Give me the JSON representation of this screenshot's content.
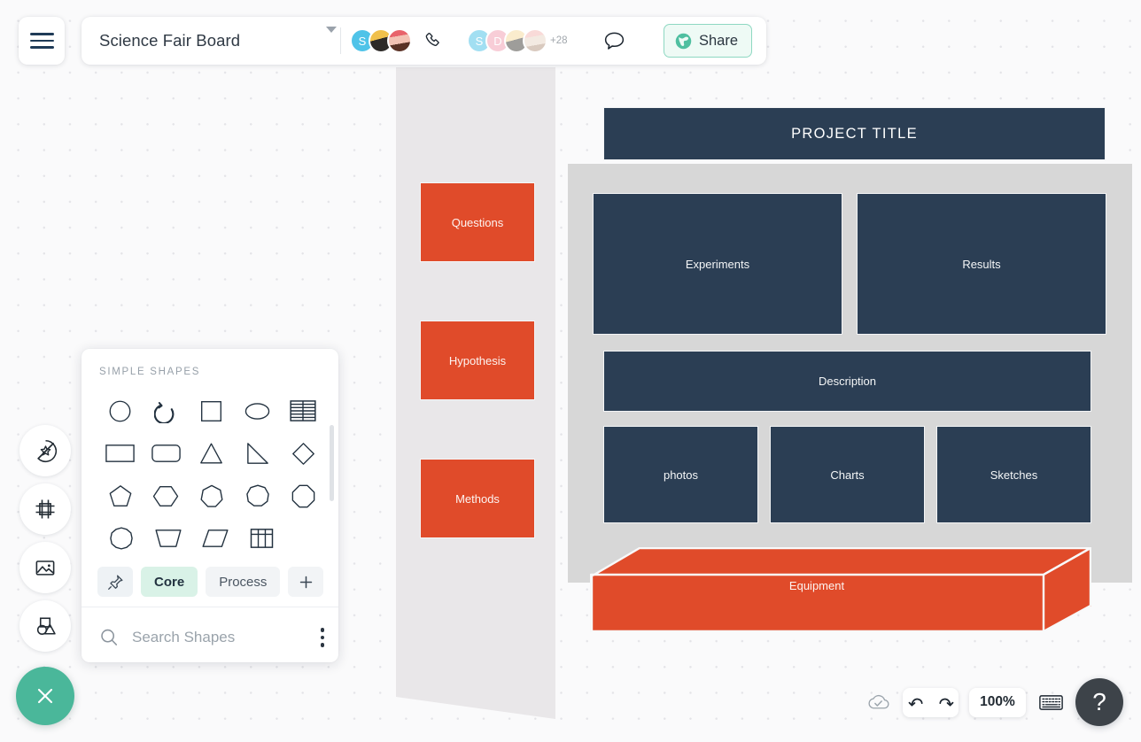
{
  "app": {
    "board_title": "Science Fair Board",
    "menu_icon": "hamburger-menu-icon",
    "title_caret_icon": "chevron-down-icon",
    "call_icon": "phone-icon",
    "comment_icon": "comment-bubble-icon",
    "share_label": "Share",
    "share_icon": "globe-icon",
    "overflow_count": "+28"
  },
  "collaborators": {
    "active": [
      {
        "name": "S",
        "type": "initial",
        "color": "#4fc3e8"
      },
      {
        "name": "avatar-photo-1",
        "type": "photo"
      },
      {
        "name": "avatar-photo-2",
        "type": "photo"
      }
    ],
    "viewers": [
      {
        "name": "S",
        "type": "initial",
        "color": "#4fc3e8"
      },
      {
        "name": "D",
        "type": "initial",
        "color": "#f2a0b4"
      },
      {
        "name": "avatar-photo-3",
        "type": "photo"
      },
      {
        "name": "avatar-photo-4",
        "type": "photo"
      }
    ]
  },
  "rail": {
    "items": [
      {
        "name": "sticker-tool",
        "icon": "star-sticker-icon"
      },
      {
        "name": "frame-tool",
        "icon": "frame-icon"
      },
      {
        "name": "image-tool",
        "icon": "image-icon"
      },
      {
        "name": "shapes-tool",
        "icon": "shapes-icon"
      }
    ],
    "close_icon": "close-x-icon"
  },
  "shapes_panel": {
    "header": "SIMPLE SHAPES",
    "shapes": [
      [
        "circle",
        "arc-arrow",
        "square",
        "ellipse",
        "table-lines"
      ],
      [
        "rectangle",
        "rounded-rectangle",
        "triangle",
        "right-triangle",
        "diamond"
      ],
      [
        "pentagon",
        "hexagon",
        "heptagon",
        "nonagon",
        "octagon"
      ],
      [
        "decagon",
        "trapezoid",
        "parallelogram",
        "table-grid"
      ]
    ],
    "tabs": [
      {
        "label": "",
        "name": "pin-tab",
        "icon": "pin-icon",
        "active": false
      },
      {
        "label": "Core",
        "name": "core-tab",
        "active": true
      },
      {
        "label": "Process",
        "name": "process-tab",
        "active": false
      },
      {
        "label": "",
        "name": "add-tab",
        "icon": "plus-icon",
        "active": false
      }
    ],
    "search_placeholder": "Search Shapes",
    "search_value": "",
    "search_icon": "search-icon",
    "more_icon": "more-vertical-icon"
  },
  "board": {
    "project_title": "PROJECT TITLE",
    "orange_color": "#e04b2a",
    "navy_color": "#2b3e54",
    "gray_color": "#d7d7d7",
    "left_cards": [
      {
        "label": "Questions"
      },
      {
        "label": "Hypothesis"
      },
      {
        "label": "Methods"
      }
    ],
    "navy_cards": [
      {
        "label": "Experiments"
      },
      {
        "label": "Results"
      },
      {
        "label": "Description"
      },
      {
        "label": "photos"
      },
      {
        "label": "Charts"
      },
      {
        "label": "Sketches"
      }
    ],
    "equipment_label": "Equipment"
  },
  "bottom_toolbar": {
    "save_status_icon": "cloud-check-icon",
    "undo_icon": "undo-arrow-icon",
    "redo_icon": "redo-arrow-icon",
    "zoom_level": "100%",
    "keyboard_icon": "keyboard-icon",
    "help_label": "?"
  }
}
